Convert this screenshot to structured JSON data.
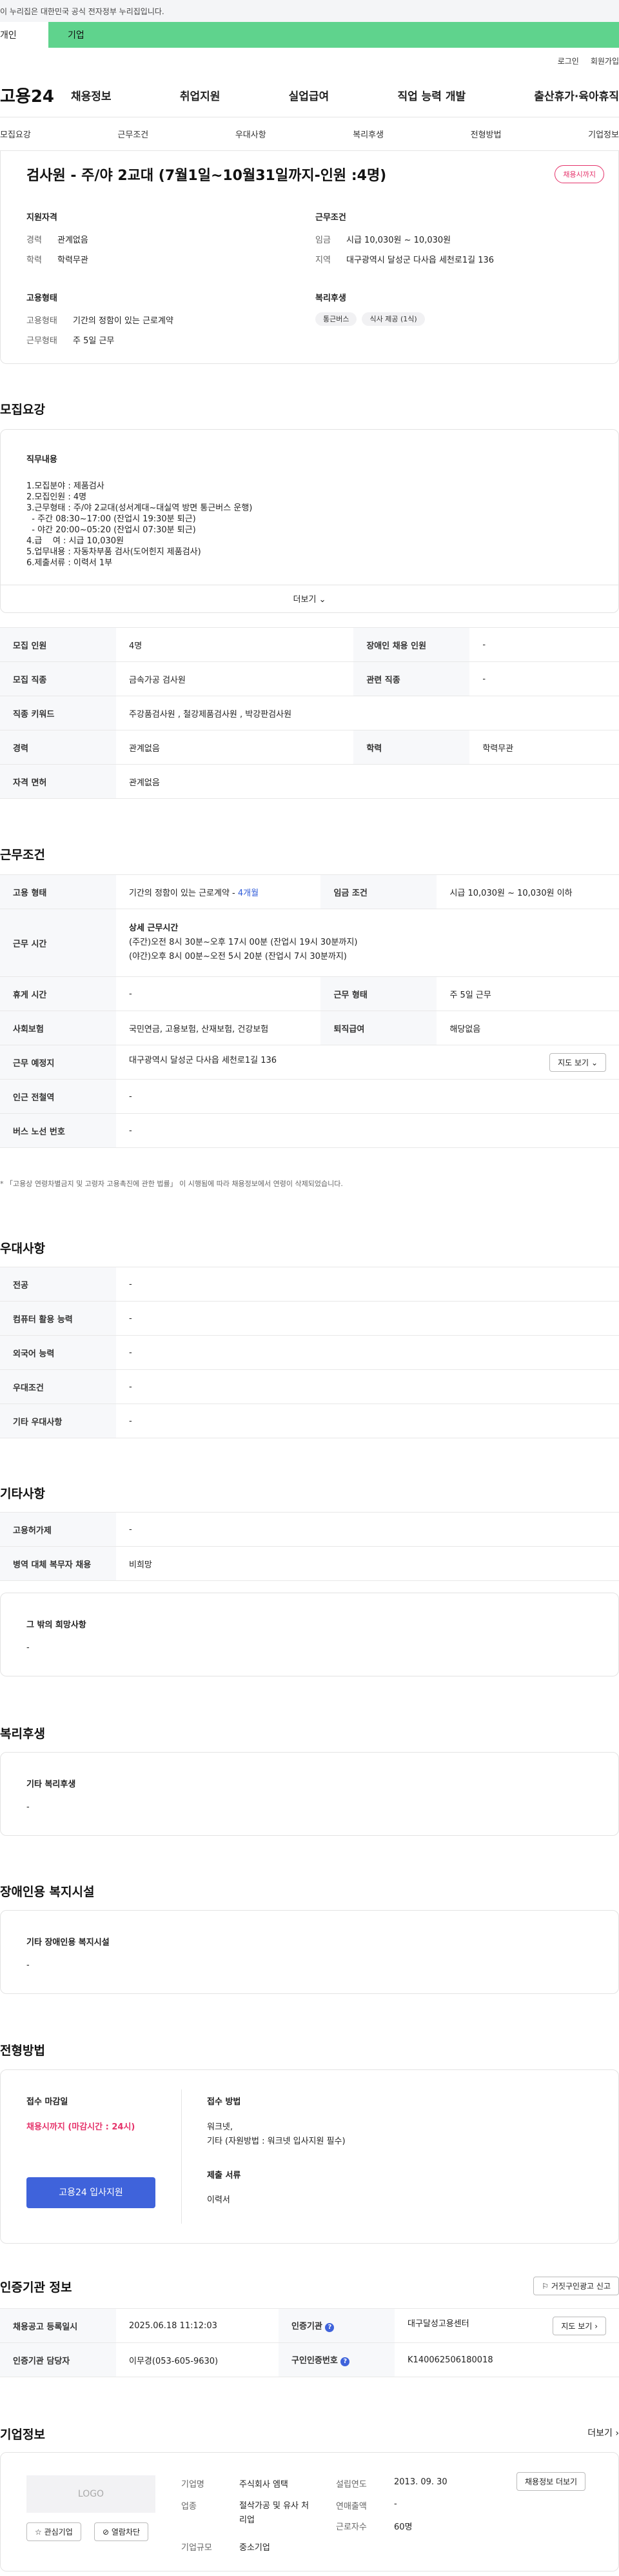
{
  "gov_notice": "이 누리집은 대한민국 공식 전자정부 누리집입니다.",
  "tabs": [
    "개인",
    "기업"
  ],
  "util_links": [
    "로그인",
    "회원가입"
  ],
  "logo": "고용24",
  "gnb": [
    "채용정보",
    "취업지원",
    "실업급여",
    "직업 능력 개발",
    "출산휴가·육아휴직"
  ],
  "subnav": [
    "모집요강",
    "근무조건",
    "우대사항",
    "복리후생",
    "전형방법",
    "기업정보"
  ],
  "job": {
    "title": "검사원 - 주/야 2교대 (7월1일~10월31일까지-인원 :4명)",
    "badge": "채용시까지",
    "qual_heading": "지원자격",
    "qual": [
      {
        "k": "경력",
        "v": "관계없음"
      },
      {
        "k": "학력",
        "v": "학력무관"
      }
    ],
    "cond_heading": "근무조건",
    "cond": [
      {
        "k": "임금",
        "v": "시급 10,030원 ~ 10,030원"
      },
      {
        "k": "지역",
        "v": "대구광역시 달성군 다사읍 세천로1길 136"
      }
    ],
    "emp_heading": "고용형태",
    "emp": [
      {
        "k": "고용형태",
        "v": "기간의 정함이 있는 근로계약"
      },
      {
        "k": "근무형태",
        "v": "주 5일 근무"
      }
    ],
    "welfare_heading": "복리후생",
    "welfare_chips": [
      "통근버스",
      "식사 제공 (1식)"
    ]
  },
  "recruit": {
    "title": "모집요강",
    "duty_heading": "직무내용",
    "duty_lines": [
      "1.모집분야 : 제품검사",
      "2.모집인원 : 4명",
      "3.근무형태 : 주/야 2교대(성서계대~대실역 방면 통근버스 운행)",
      "  - 주간 08:30~17:00 (잔업시 19:30분 퇴근)",
      "  - 야간 20:00~05:20 (잔업시 07:30분 퇴근)",
      "4.급    여 : 시급 10,030원",
      "5.업무내용 : 자동차부품 검사(도어힌지 제품검사)",
      "6.제출서류 : 이력서 1부"
    ],
    "more": "더보기",
    "rows": [
      [
        {
          "k": "모집 인원",
          "v": "4명"
        },
        {
          "k": "장애인 채용 인원",
          "v": "-"
        }
      ],
      [
        {
          "k": "모집 직종",
          "v": "금속가공 검사원"
        },
        {
          "k": "관련 직종",
          "v": "-"
        }
      ],
      [
        {
          "k": "직종 키워드",
          "v": "주강품검사원 , 철강제품검사원 , 박강판검사원"
        }
      ],
      [
        {
          "k": "경력",
          "v": "관계없음"
        },
        {
          "k": "학력",
          "v": "학력무관"
        }
      ],
      [
        {
          "k": "자격 면허",
          "v": "관계없음"
        }
      ]
    ]
  },
  "work": {
    "title": "근무조건",
    "emp_type_k": "고용 형태",
    "emp_type_v": "기간의 정함이 있는 근로계약 - ",
    "emp_type_v2": "4개월",
    "wage_k": "임금 조건",
    "wage_v": "시급 10,030원 ~ 10,030원 이하",
    "hours_k": "근무 시간",
    "hours_h": "상세 근무시간",
    "hours_1": "(주간)오전 8시 30분~오후 17시 00분 (잔업시 19시 30분까지)",
    "hours_2": "(야간)오후 8시 00분~오전 5시 20분 (잔업시 7시 30분까지)",
    "rest_k": "휴게 시간",
    "rest_v": "-",
    "shift_k": "근무 형태",
    "shift_v": "주 5일 근무",
    "ins_k": "사회보험",
    "ins_v": "국민연금, 고용보험, 산재보험, 건강보험",
    "sev_k": "퇴직급여",
    "sev_v": "해당없음",
    "place_k": "근무 예정지",
    "place_v": "대구광역시 달성군 다사읍 세천로1길 136",
    "map_btn": "지도 보기",
    "subway_k": "인근 전철역",
    "subway_v": "-",
    "bus_k": "버스 노선 번호",
    "bus_v": "-",
    "note": "* 「고용상 연령차별금지 및 고령자 고용촉진에 관한 법률」 이 시행됨에 따라 채용정보에서 연령이 삭제되었습니다."
  },
  "pref": {
    "title": "우대사항",
    "rows": [
      {
        "k": "전공",
        "v": "-"
      },
      {
        "k": "컴퓨터 활용 능력",
        "v": "-"
      },
      {
        "k": "외국어 능력",
        "v": "-"
      },
      {
        "k": "우대조건",
        "v": "-"
      },
      {
        "k": "기타 우대사항",
        "v": "-"
      }
    ]
  },
  "etc": {
    "title": "기타사항",
    "rows": [
      {
        "k": "고용허가제",
        "v": "-"
      },
      {
        "k": "병역 대체 복무자 채용",
        "v": "비희망"
      }
    ],
    "box_h": "그 밖의 희망사항",
    "box_v": "-"
  },
  "welfare": {
    "title": "복리후생",
    "box_h": "기타 복리후생",
    "box_v": "-"
  },
  "disability": {
    "title": "장애인용 복지시설",
    "box_h": "기타 장애인용 복지시설",
    "box_v": "-"
  },
  "process": {
    "title": "전형방법",
    "deadline_h": "접수 마감일",
    "deadline_v": "채용시까지 (마감시간 : 24시)",
    "apply_btn": "고용24 입사지원",
    "method_h": "접수 방법",
    "method_v1": "워크넷,",
    "method_v2": "기타 (자원방법 : 워크넷 입사지원 필수)",
    "docs_h": "제출 서류",
    "docs_v": "이력서"
  },
  "agency": {
    "title": "인증기관 정보",
    "report_btn": "거짓구인광고 신고",
    "reg_k": "채용공고 등록일시",
    "reg_v": "2025.06.18 11:12:03",
    "org_k": "인증기관",
    "org_v": "대구달성고용센터",
    "map_btn": "지도 보기",
    "mgr_k": "인증기관 담당자",
    "mgr_v": "이무경(053-605-9630)",
    "no_k": "구인인증번호",
    "no_v": "K140062506180018"
  },
  "company": {
    "title": "기업정보",
    "more": "더보기",
    "logo_ph": "LOGO",
    "fav_btn": "관심기업",
    "block_btn": "열람차단",
    "name_k": "기업명",
    "name_v": "주식회사 엠택",
    "ind_k": "업종",
    "ind_v": "절삭가공 및 유사 처리업",
    "size_k": "기업규모",
    "size_v": "중소기업",
    "est_k": "설립연도",
    "est_v": "2013. 09. 30",
    "sales_k": "연매출액",
    "sales_v": "-",
    "emp_k": "근로자수",
    "emp_v": "60명",
    "jobs_btn": "채용정보 더보기"
  },
  "colors": {
    "green_tab": "#5fd38d",
    "accent_red": "#e5336b",
    "primary_blue": "#3f63db"
  }
}
